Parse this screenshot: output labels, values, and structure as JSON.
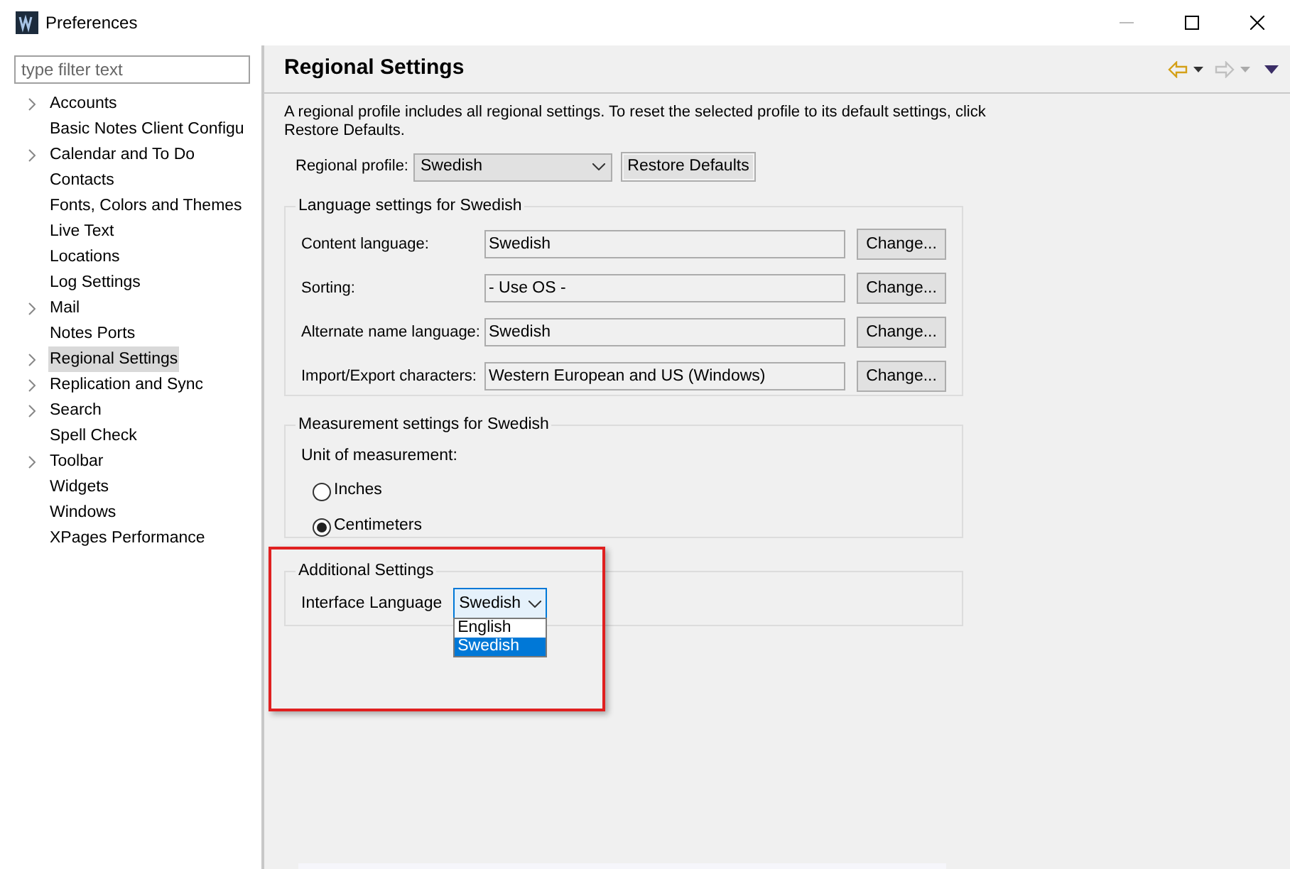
{
  "window": {
    "title": "Preferences"
  },
  "filter": {
    "placeholder": "type filter text"
  },
  "tree": [
    {
      "label": "Accounts",
      "expandable": true,
      "selected": false
    },
    {
      "label": "Basic Notes Client Configu",
      "expandable": false,
      "selected": false
    },
    {
      "label": "Calendar and To Do",
      "expandable": true,
      "selected": false
    },
    {
      "label": "Contacts",
      "expandable": false,
      "selected": false
    },
    {
      "label": "Fonts, Colors and Themes",
      "expandable": false,
      "selected": false
    },
    {
      "label": "Live Text",
      "expandable": false,
      "selected": false
    },
    {
      "label": "Locations",
      "expandable": false,
      "selected": false
    },
    {
      "label": "Log Settings",
      "expandable": false,
      "selected": false
    },
    {
      "label": "Mail",
      "expandable": true,
      "selected": false
    },
    {
      "label": "Notes Ports",
      "expandable": false,
      "selected": false
    },
    {
      "label": "Regional Settings",
      "expandable": true,
      "selected": true
    },
    {
      "label": "Replication and Sync",
      "expandable": true,
      "selected": false
    },
    {
      "label": "Search",
      "expandable": true,
      "selected": false
    },
    {
      "label": "Spell Check",
      "expandable": false,
      "selected": false
    },
    {
      "label": "Toolbar",
      "expandable": true,
      "selected": false
    },
    {
      "label": "Widgets",
      "expandable": false,
      "selected": false
    },
    {
      "label": "Windows",
      "expandable": false,
      "selected": false
    },
    {
      "label": "XPages Performance",
      "expandable": false,
      "selected": false
    }
  ],
  "page": {
    "title": "Regional Settings",
    "description": "A regional profile includes all regional settings.  To reset the selected profile to its default settings, click Restore Defaults."
  },
  "regional_profile": {
    "label": "Regional profile:",
    "value": "Swedish",
    "button": "Restore Defaults"
  },
  "language_group": {
    "title": "Language settings for Swedish",
    "rows": [
      {
        "label": "Content language:",
        "value": "Swedish",
        "button": "Change..."
      },
      {
        "label": "Sorting:",
        "value": "- Use OS -",
        "button": "Change..."
      },
      {
        "label": "Alternate name language:",
        "value": "Swedish",
        "button": "Change..."
      },
      {
        "label": "Import/Export characters:",
        "value": "Western European and US (Windows)",
        "button": "Change..."
      }
    ]
  },
  "measurement_group": {
    "title": "Measurement settings for Swedish",
    "unit_label": "Unit of measurement:",
    "options": [
      {
        "label": "Inches",
        "selected": false
      },
      {
        "label": "Centimeters",
        "selected": true
      }
    ]
  },
  "additional_group": {
    "title": "Additional Settings",
    "label": "Interface Language",
    "value": "Swedish",
    "options": [
      {
        "label": "English",
        "selected": false
      },
      {
        "label": "Swedish",
        "selected": true
      }
    ]
  }
}
